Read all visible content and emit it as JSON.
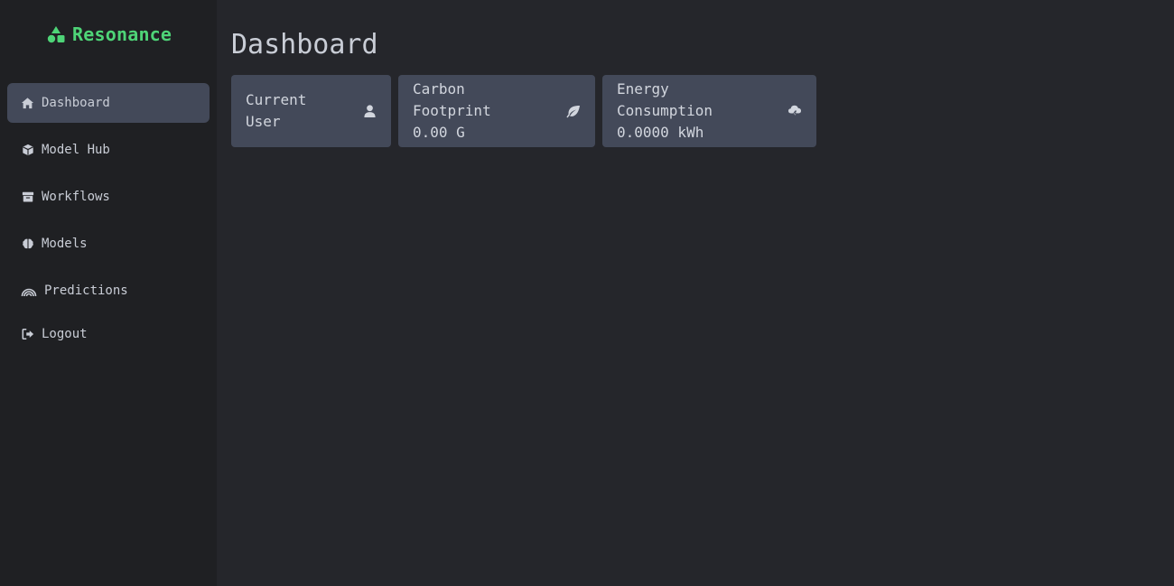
{
  "brand": {
    "name": "Resonance",
    "color": "#4ed477"
  },
  "sidebar": {
    "items": [
      {
        "label": "Dashboard",
        "icon": "home-icon",
        "active": true
      },
      {
        "label": "Model Hub",
        "icon": "cube-icon",
        "active": false
      },
      {
        "label": "Workflows",
        "icon": "archive-icon",
        "active": false
      },
      {
        "label": "Models",
        "icon": "brain-icon",
        "active": false
      },
      {
        "label": "Predictions",
        "icon": "rainbow-icon",
        "active": false
      },
      {
        "label": "Logout",
        "icon": "logout-icon",
        "active": false
      }
    ]
  },
  "main": {
    "title": "Dashboard",
    "cards": {
      "user": {
        "label": "Current User",
        "icon": "user-icon"
      },
      "carbon": {
        "label": "Carbon Footprint",
        "value": "0.00 G",
        "icon": "leaf-icon"
      },
      "energy": {
        "label": "Energy Consumption",
        "value": "0.0000 kWh",
        "icon": "cloud-bolt-icon"
      }
    }
  },
  "colors": {
    "background": "#25262b",
    "sidebar": "#1f2023",
    "card": "#434959",
    "active_item": "#434959",
    "text": "#c9cdd6"
  }
}
